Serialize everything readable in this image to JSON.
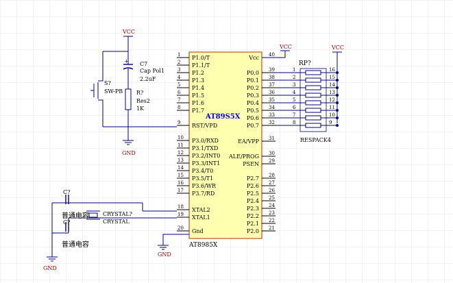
{
  "chip": {
    "name": "AT89S5X",
    "designator": "AT8985X",
    "left_pins": [
      {
        "num": "1",
        "label": "P1.0/T"
      },
      {
        "num": "2",
        "label": "P1.1/T"
      },
      {
        "num": "3",
        "label": "P1.2"
      },
      {
        "num": "4",
        "label": "P1.3"
      },
      {
        "num": "5",
        "label": "P1.4"
      },
      {
        "num": "6",
        "label": "P1.5"
      },
      {
        "num": "7",
        "label": "P1.6"
      },
      {
        "num": "8",
        "label": "P1.7"
      },
      {
        "num": "9",
        "label": "RST/VPD"
      },
      {
        "num": "10",
        "label": "P3.0/RXD"
      },
      {
        "num": "11",
        "label": "P3.1/TXD"
      },
      {
        "num": "12",
        "label": "P3.2/INT0"
      },
      {
        "num": "13",
        "label": "P3.3/INT1"
      },
      {
        "num": "14",
        "label": "P3.4/T0"
      },
      {
        "num": "15",
        "label": "P3.5/T1"
      },
      {
        "num": "16",
        "label": "P3.6/WR"
      },
      {
        "num": "17",
        "label": "P3.7/RD"
      },
      {
        "num": "18",
        "label": "XTAL2"
      },
      {
        "num": "19",
        "label": "XTAL1"
      },
      {
        "num": "20",
        "label": "Gnd"
      }
    ],
    "right_pins": [
      {
        "num": "40",
        "label": "Vcc"
      },
      {
        "num": "39",
        "label": "P0.0"
      },
      {
        "num": "38",
        "label": "P0.1"
      },
      {
        "num": "37",
        "label": "P0.2"
      },
      {
        "num": "36",
        "label": "P0.3"
      },
      {
        "num": "35",
        "label": "P0.4"
      },
      {
        "num": "34",
        "label": "P0.5"
      },
      {
        "num": "33",
        "label": "P0.6"
      },
      {
        "num": "32",
        "label": "P0.7"
      },
      {
        "num": "31",
        "label": "EA/VPP"
      },
      {
        "num": "30",
        "label": "ALE/PROG"
      },
      {
        "num": "29",
        "label": "PSEN"
      },
      {
        "num": "28",
        "label": "P2.7"
      },
      {
        "num": "27",
        "label": "P2.6"
      },
      {
        "num": "26",
        "label": "P2.5"
      },
      {
        "num": "25",
        "label": "P2.4"
      },
      {
        "num": "24",
        "label": "P2.3"
      },
      {
        "num": "23",
        "label": "P2.2"
      },
      {
        "num": "22",
        "label": "P2.1"
      },
      {
        "num": "21",
        "label": "P2.0"
      }
    ]
  },
  "resistor_pack": {
    "designator": "RP?",
    "value": "RESPACK4",
    "left_nums": [
      "1",
      "2",
      "3",
      "4",
      "5",
      "6",
      "7",
      "8"
    ],
    "right_nums": [
      "16",
      "15",
      "14",
      "13",
      "12",
      "11",
      "10",
      "9"
    ]
  },
  "power": {
    "vcc_label": "VCC",
    "gnd_label": "GND"
  },
  "reset": {
    "cap_ref": "C7",
    "cap_type": "Cap Pol1",
    "cap_value": "2.2uF",
    "switch_ref": "S?",
    "switch_type": "SW-PB",
    "res_ref": "R?",
    "res_type": "Res2",
    "res_value": "1K"
  },
  "oscillator": {
    "cap_top_ref": "C?",
    "cap_top_label": "普通电容",
    "cap_bottom_ref": "C?",
    "cap_bottom_label": "普通电容",
    "crystal_ref": "CRYSTAL?",
    "crystal_type": "CRYSTAL"
  },
  "colors": {
    "wire": "#000080",
    "pin": "#000000",
    "chip_fill": "#ffffb0",
    "chip_border": "#c05020",
    "name_text": "#0000ff",
    "power_text": "#a00000",
    "net_text": "#000000",
    "grid": "#e6e6e6"
  }
}
